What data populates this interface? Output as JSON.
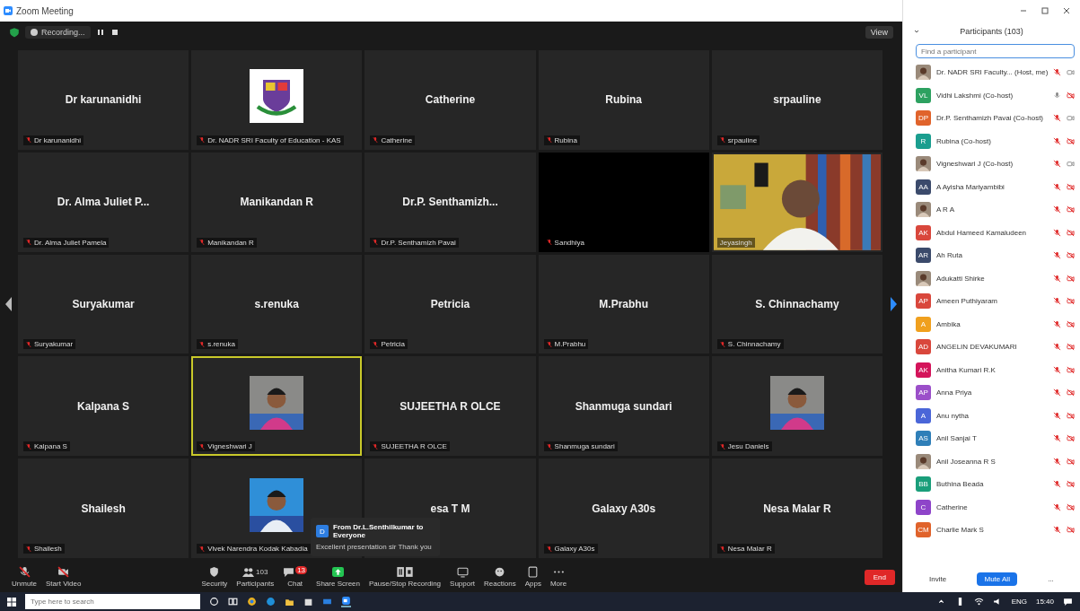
{
  "window": {
    "title": "Zoom Meeting"
  },
  "recording": {
    "label": "Recording..."
  },
  "view_button": "View",
  "tiles": [
    {
      "kind": "name",
      "name": "Dr karunanidhi",
      "label": "Dr karunanidhi",
      "muted": true,
      "selected": false
    },
    {
      "kind": "logo",
      "label": "Dr. NADR SRI Faculty of Education - KAS",
      "muted": true,
      "selected": false
    },
    {
      "kind": "name",
      "name": "Catherine",
      "label": "Catherine",
      "muted": true,
      "selected": false
    },
    {
      "kind": "name",
      "name": "Rubina",
      "label": "Rubina",
      "muted": true,
      "selected": false
    },
    {
      "kind": "name",
      "name": "srpauline",
      "label": "srpauline",
      "muted": true,
      "selected": false
    },
    {
      "kind": "name",
      "name": "Dr. Alma Juliet P...",
      "label": "Dr. Alma Juliet Pamela",
      "muted": true,
      "selected": false
    },
    {
      "kind": "name",
      "name": "Manikandan R",
      "label": "Manikandan R",
      "muted": true,
      "selected": false
    },
    {
      "kind": "name",
      "name": "Dr.P. Senthamizh...",
      "label": "Dr.P. Senthamizh Pavai",
      "muted": true,
      "selected": false
    },
    {
      "kind": "black",
      "label": "Sandhiya",
      "muted": true,
      "selected": false
    },
    {
      "kind": "video",
      "label": "Jeyasingh",
      "muted": false,
      "selected": false
    },
    {
      "kind": "name",
      "name": "Suryakumar",
      "label": "Suryakumar",
      "muted": true,
      "selected": false
    },
    {
      "kind": "name",
      "name": "s.renuka",
      "label": "s.renuka",
      "muted": true,
      "selected": false
    },
    {
      "kind": "name",
      "name": "Petricia",
      "label": "Petricia",
      "muted": true,
      "selected": false
    },
    {
      "kind": "name",
      "name": "M.Prabhu",
      "label": "M.Prabhu",
      "muted": true,
      "selected": false
    },
    {
      "kind": "name",
      "name": "S. Chinnachamy",
      "label": "S. Chinnachamy",
      "muted": true,
      "selected": false
    },
    {
      "kind": "name",
      "name": "Kalpana S",
      "label": "Kalpana S",
      "muted": true,
      "selected": false
    },
    {
      "kind": "picture",
      "label": "Vigneshwari J",
      "muted": true,
      "selected": true
    },
    {
      "kind": "name",
      "name": "SUJEETHA R OLCE",
      "label": "SUJEETHA R OLCE",
      "muted": true,
      "selected": false
    },
    {
      "kind": "name",
      "name": "Shanmuga sundari",
      "label": "Shanmuga sundari",
      "muted": true,
      "selected": false
    },
    {
      "kind": "picture",
      "label": "Jesu Daniels",
      "muted": true,
      "selected": false
    },
    {
      "kind": "name",
      "name": "Shailesh",
      "label": "Shailesh",
      "muted": true,
      "selected": false
    },
    {
      "kind": "picture",
      "label": "Vivek Narendra Kodak Kabadia",
      "muted": true,
      "selected": false
    },
    {
      "kind": "name",
      "name": "esa T M",
      "selected": false
    },
    {
      "kind": "name",
      "name": "Galaxy A30s",
      "label": "Galaxy A30s",
      "muted": true,
      "selected": false
    },
    {
      "kind": "name",
      "name": "Nesa Malar R",
      "label": "Nesa Malar R",
      "muted": true,
      "selected": false
    }
  ],
  "chat_popup": {
    "avatar": "D",
    "from": "From Dr.L.Senthilkumar to Everyone",
    "message": "Excellent presentation sir Thank you"
  },
  "toolbar": [
    {
      "kind": "mic",
      "label": "Unmute"
    },
    {
      "kind": "video",
      "label": "Start Video"
    },
    {
      "kind": "shield",
      "label": "Security"
    },
    {
      "kind": "people",
      "label": "Participants",
      "count": "103"
    },
    {
      "kind": "chat",
      "label": "Chat",
      "badge": "13"
    },
    {
      "kind": "share",
      "label": "Share Screen"
    },
    {
      "kind": "record",
      "label": "Pause/Stop Recording"
    },
    {
      "kind": "support",
      "label": "Support"
    },
    {
      "kind": "react",
      "label": "Reactions"
    },
    {
      "kind": "apps",
      "label": "Apps"
    },
    {
      "kind": "more",
      "label": "More"
    }
  ],
  "end_button": "End",
  "panel": {
    "title": "Participants (103)",
    "search": {
      "placeholder": "Find a participant"
    }
  },
  "participants": [
    {
      "name": "Dr. NADR SRI Faculty... (Host, me)",
      "photo": true,
      "video_off": false,
      "muted": true
    },
    {
      "name": "Vidhi Lakshmi (Co-host)",
      "avatar": "VL",
      "color": "#2da160",
      "video_off": true,
      "muted": false
    },
    {
      "name": "Dr.P. Senthamizh Pavai (Co-host)",
      "avatar": "DP",
      "color": "#e0632b",
      "video_off": false,
      "muted": true
    },
    {
      "name": "Rubina (Co-host)",
      "avatar": "R",
      "color": "#1a9e8f",
      "video_off": true,
      "muted": true
    },
    {
      "name": "Vigneshwari J (Co-host)",
      "photo": true,
      "video_off": false,
      "muted": true
    },
    {
      "name": "A Ayisha Mariyambibi",
      "avatar": "AA",
      "color": "#3b4a6b",
      "video_off": true,
      "muted": true
    },
    {
      "name": "A R A",
      "photo": true,
      "video_off": true,
      "muted": true
    },
    {
      "name": "Abdul Hameed Kamaludeen",
      "avatar": "AK",
      "color": "#d9473c",
      "video_off": true,
      "muted": true
    },
    {
      "name": "Ah Ruta",
      "avatar": "AR",
      "color": "#3b4a6b",
      "video_off": true,
      "muted": true
    },
    {
      "name": "Adukatti Shirke",
      "photo": true,
      "video_off": true,
      "muted": true
    },
    {
      "name": "Ameen Puthiyaram",
      "avatar": "AP",
      "color": "#d9473c",
      "video_off": true,
      "muted": true
    },
    {
      "name": "Ambika",
      "avatar": "A",
      "color": "#f0a01e",
      "video_off": true,
      "muted": true
    },
    {
      "name": "ANGELIN DEVAKUMARI",
      "avatar": "AD",
      "color": "#d9473c",
      "video_off": true,
      "muted": true
    },
    {
      "name": "Anitha Kumari R.K",
      "avatar": "AK",
      "color": "#d4145a",
      "video_off": true,
      "muted": true
    },
    {
      "name": "Anna Priya",
      "avatar": "AP",
      "color": "#9b4fc9",
      "video_off": true,
      "muted": true
    },
    {
      "name": "Anu nytha",
      "avatar": "A",
      "color": "#4a66d8",
      "video_off": true,
      "muted": true
    },
    {
      "name": "Anil Sanjai T",
      "avatar": "AS",
      "color": "#2f7fb8",
      "video_off": true,
      "muted": true
    },
    {
      "name": "Anil Joseanna R S",
      "photo": true,
      "video_off": true,
      "muted": true
    },
    {
      "name": "Buthina Beada",
      "avatar": "BB",
      "color": "#1a9e7a",
      "video_off": true,
      "muted": true
    },
    {
      "name": "Catherine",
      "avatar": "C",
      "color": "#8e44c9",
      "video_off": true,
      "muted": true
    },
    {
      "name": "Charlie Mark S",
      "avatar": "CM",
      "color": "#e0632b",
      "video_off": true,
      "muted": true
    }
  ],
  "panel_buttons": [
    {
      "kind": "plain",
      "label": "Invite"
    },
    {
      "kind": "primary",
      "label": "Mute All"
    },
    {
      "kind": "more",
      "label": "..."
    }
  ],
  "taskbar": {
    "search": {
      "placeholder": "Type here to search"
    },
    "language": "ENG",
    "time": "15:40"
  }
}
